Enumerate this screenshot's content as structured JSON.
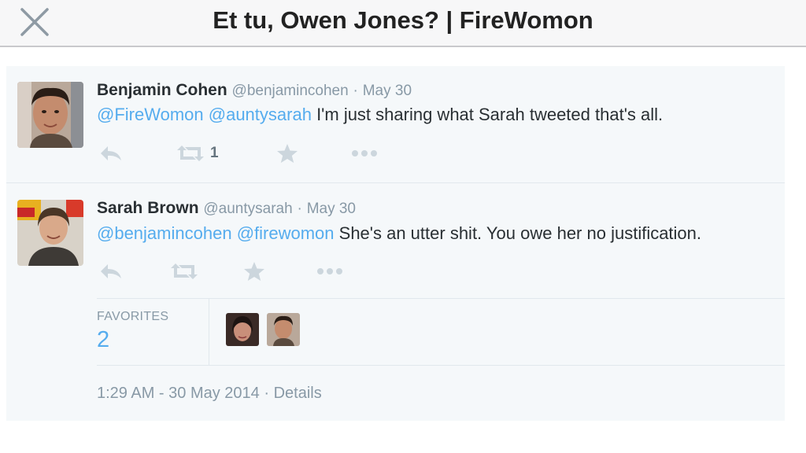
{
  "header": {
    "title": "Et tu, Owen Jones? | FireWomon",
    "close_icon": "close-icon"
  },
  "tweets": [
    {
      "name": "Benjamin Cohen",
      "handle": "@benjamincohen",
      "separator": "·",
      "date": "May 30",
      "mentions": [
        "@FireWomon",
        "@auntysarah"
      ],
      "text": "I'm just sharing what Sarah tweeted that's all.",
      "retweet_count": "1",
      "icons": [
        "reply-icon",
        "retweet-icon",
        "favorite-icon",
        "more-icon"
      ]
    },
    {
      "name": "Sarah Brown",
      "handle": "@auntysarah",
      "separator": "·",
      "date": "May 30",
      "mentions": [
        "@benjamincohen",
        "@firewomon"
      ],
      "text": "She's an utter shit. You owe her no justification.",
      "icons": [
        "reply-icon",
        "retweet-icon",
        "favorite-icon",
        "more-icon"
      ],
      "favorites_label": "FAVORITES",
      "favorites_count": "2",
      "timestamp": "1:29 AM - 30 May 2014",
      "details_label": "Details"
    }
  ],
  "colors": {
    "link": "#55acee",
    "muted": "#8899a6",
    "text": "#292f33",
    "card_bg": "#f5f8fa",
    "action_icon": "#ccd6dd"
  }
}
